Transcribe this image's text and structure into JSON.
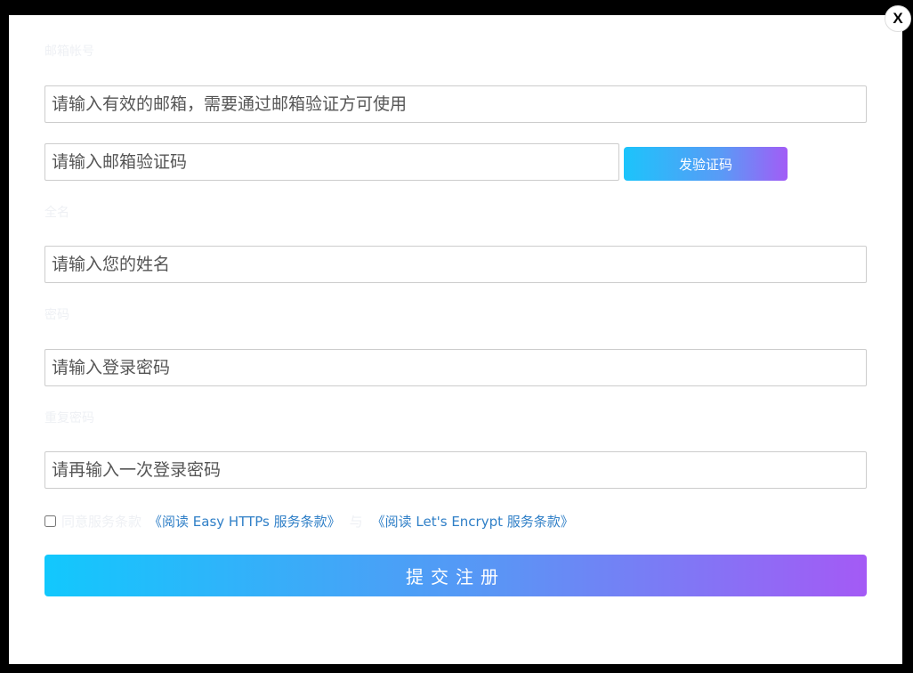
{
  "close_label": "X",
  "email_label": "邮箱帐号",
  "email_placeholder": "请输入有效的邮箱，需要通过邮箱验证方可使用",
  "code_placeholder": "请输入邮箱验证码",
  "send_code_label": "发验证码",
  "name_label": "全名",
  "name_placeholder": "请输入您的姓名",
  "password_label": "密码",
  "password_placeholder": "请输入登录密码",
  "confirm_label": "重复密码",
  "confirm_placeholder": "请再输入一次登录密码",
  "agree": {
    "checked": false,
    "text": "同意服务条款",
    "link1": "《阅读 Easy HTTPs 服务条款》",
    "conjunction": "与",
    "link2": "《阅读 Let's Encrypt 服务条款》"
  },
  "submit_label": "提交注册",
  "colors": {
    "gradient_start": "#12c8fd",
    "gradient_end": "#a45af5",
    "link": "#2f7fc7"
  }
}
